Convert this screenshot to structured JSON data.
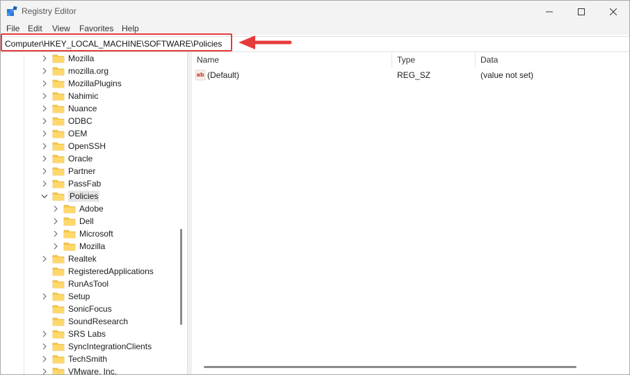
{
  "window": {
    "title": "Registry Editor"
  },
  "menu": [
    "File",
    "Edit",
    "View",
    "Favorites",
    "Help"
  ],
  "address": {
    "path": "Computer\\HKEY_LOCAL_MACHINE\\SOFTWARE\\Policies"
  },
  "tree": {
    "items": [
      {
        "label": "Mozilla",
        "level": 1
      },
      {
        "label": "mozilla.org",
        "level": 1
      },
      {
        "label": "MozillaPlugins",
        "level": 1
      },
      {
        "label": "Nahimic",
        "level": 1
      },
      {
        "label": "Nuance",
        "level": 1
      },
      {
        "label": "ODBC",
        "level": 1
      },
      {
        "label": "OEM",
        "level": 1
      },
      {
        "label": "OpenSSH",
        "level": 1
      },
      {
        "label": "Oracle",
        "level": 1
      },
      {
        "label": "Partner",
        "level": 1
      },
      {
        "label": "PassFab",
        "level": 1
      },
      {
        "label": "Policies",
        "level": 1,
        "expanded": true,
        "selected": true
      },
      {
        "label": "Adobe",
        "level": 2
      },
      {
        "label": "Dell",
        "level": 2
      },
      {
        "label": "Microsoft",
        "level": 2
      },
      {
        "label": "Mozilla",
        "level": 2
      },
      {
        "label": "Realtek",
        "level": 1
      },
      {
        "label": "RegisteredApplications",
        "level": 1,
        "no_chevron": true
      },
      {
        "label": "RunAsTool",
        "level": 1,
        "no_chevron": true
      },
      {
        "label": "Setup",
        "level": 1
      },
      {
        "label": "SonicFocus",
        "level": 1,
        "no_chevron": true
      },
      {
        "label": "SoundResearch",
        "level": 1,
        "no_chevron": true
      },
      {
        "label": "SRS Labs",
        "level": 1
      },
      {
        "label": "SyncIntegrationClients",
        "level": 1
      },
      {
        "label": "TechSmith",
        "level": 1
      },
      {
        "label": "VMware, Inc.",
        "level": 1
      }
    ]
  },
  "list": {
    "columns": [
      "Name",
      "Type",
      "Data"
    ],
    "rows": [
      {
        "name": "(Default)",
        "type": "REG_SZ",
        "data": "(value not set)",
        "icon": "string-value-icon"
      }
    ]
  },
  "colors": {
    "highlight": "#e63b3b",
    "folder": "#f7c948"
  }
}
